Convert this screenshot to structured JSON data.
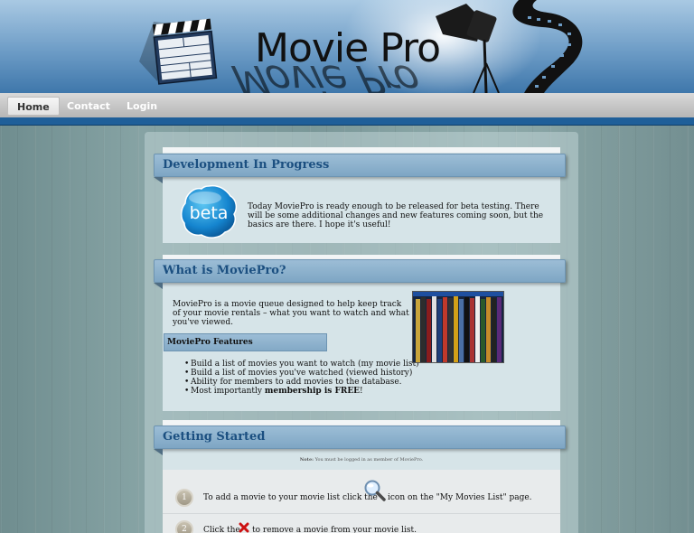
{
  "header": {
    "logo_text": "Movie Pro",
    "logo_reflection": "Movie Pro"
  },
  "nav": {
    "items": [
      {
        "label": "Home",
        "active": true
      },
      {
        "label": "Contact",
        "active": false
      },
      {
        "label": "Login",
        "active": false
      }
    ]
  },
  "sections": {
    "development": {
      "title": "Development In Progress",
      "badge": "beta",
      "text": "Today MoviePro is ready enough to be released for beta testing. There will be some additional changes and new features coming soon, but the basics are there. I hope it's useful!"
    },
    "what_is": {
      "title": "What is MoviePro?",
      "text": "MoviePro is a movie queue designed to help keep track of your movie rentals – what you want to watch and what you've viewed.",
      "features_title": "MoviePro Features",
      "features": [
        "Build a list of movies you want to watch (my movie list)",
        "Build a list of movies you've watched (viewed history)",
        "Ability for members to add movies to the database."
      ],
      "feature_last_prefix": "Most importantly ",
      "feature_last_bold": "membership is FREE",
      "feature_last_suffix": "!"
    },
    "getting_started": {
      "title": "Getting Started",
      "note_label": "Note:",
      "note_text": "You must be logged in as member of MoviePro.",
      "steps": [
        {
          "num": "1",
          "before": "To add a movie to your movie list click the",
          "after": "icon on the \"My Movies List\" page.",
          "icon": "search-icon"
        },
        {
          "num": "2",
          "before": "Click the",
          "after": "to remove a movie from your movie list.",
          "icon": "remove-icon"
        }
      ]
    }
  },
  "colors": {
    "header_blue": "#3f77ab",
    "nav_blue": "#1f5f99",
    "ribbon": "#8fb3cf",
    "title_text": "#1b4f80",
    "remove_red": "#cc1111"
  }
}
